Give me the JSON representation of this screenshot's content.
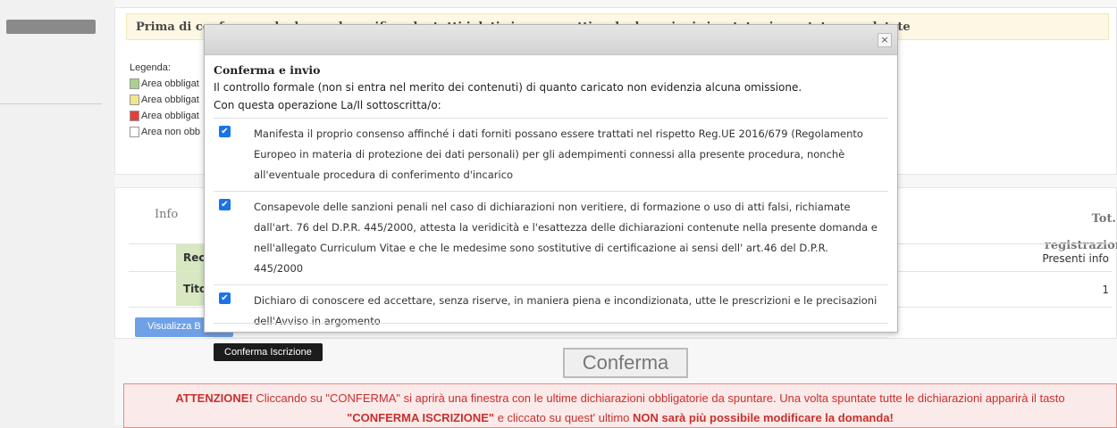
{
  "notice": "Prima di confermare la domanda verifica che tutti i dati siano corretti e che le sezioni riportate siano state completate",
  "legend": {
    "title": "Legenda:",
    "items": [
      {
        "label": "Area obbligat",
        "color": "#a9d08e"
      },
      {
        "label": "Area obbligat",
        "color": "#f0e68c"
      },
      {
        "label": "Area obbligat",
        "color": "#e0403b"
      },
      {
        "label": "Area non obb",
        "color": "#ffffff"
      }
    ]
  },
  "table": {
    "info_label": "Info",
    "total_header_1": "Tot.",
    "total_header_2": "registrazioni",
    "rows": [
      {
        "label": "Rec",
        "value": "Presenti info"
      },
      {
        "label": "Tito",
        "value": "1"
      }
    ],
    "visualizza_label": "Visualizza B"
  },
  "confirm_big": "Conferma",
  "warning": {
    "line1_strong": "ATTENZIONE!",
    "line1_rest": " Cliccando su \"CONFERMA\" si aprirà una finestra con le ultime dichiarazioni obbligatorie da spuntare. Una volta spuntate tutte le dichiarazioni apparirà il tasto",
    "line2_strong1": "\"CONFERMA ISCRIZIONE\"",
    "line2_mid": " e cliccato su quest' ultimo ",
    "line2_strong2": "NON sarà più possibile modificare la domanda!"
  },
  "modal": {
    "close_symbol": "×",
    "title": "Conferma e invio",
    "line1": "Il controllo formale (non si entra nel merito dei contenuti) di quanto caricato non evidenzia alcuna omissione.",
    "line2": "Con questa operazione La/Il sottoscritta/o:",
    "declarations": [
      {
        "checked": true,
        "text": "Manifesta il proprio consenso affinché i dati forniti possano essere trattati nel rispetto Reg.UE 2016/679 (Regolamento Europeo in materia di protezione dei dati personali) per gli adempimenti connessi alla presente procedura, nonchè all'eventuale procedura di conferimento d'incarico"
      },
      {
        "checked": true,
        "text": "Consapevole delle sanzioni penali nel caso di dichiarazioni non veritiere, di formazione o uso di atti falsi, richiamate dall'art. 76 del D.P.R. 445/2000, attesta la veridicità e l'esattezza delle dichiarazioni contenute nella presente domanda e nell'allegato Curriculum Vitae e che le medesime sono sostitutive di certificazione ai sensi dell' art.46 del D.P.R. 445/2000"
      },
      {
        "checked": true,
        "text": "Dichiaro di conoscere ed accettare, senza riserve, in maniera piena e incondizionata, utte le prescrizioni e le precisazioni dell'Avviso in argomento"
      }
    ],
    "confirm_button": "Conferma Iscrizione",
    "checkmark": "✔"
  }
}
